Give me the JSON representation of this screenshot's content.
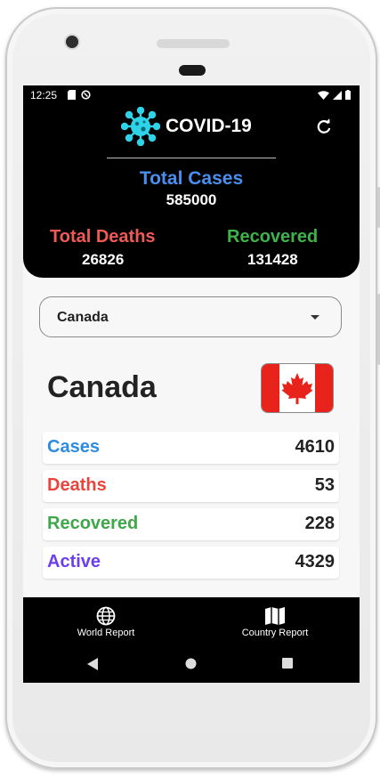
{
  "status_bar": {
    "time": "12:25"
  },
  "header": {
    "app_title": "COVID-19",
    "logo_icon": "virus-icon",
    "refresh_icon": "refresh-icon",
    "total_cases_label": "Total Cases",
    "total_cases_value": "585000",
    "total_deaths_label": "Total Deaths",
    "total_deaths_value": "26826",
    "recovered_label": "Recovered",
    "recovered_value": "131428"
  },
  "country_select": {
    "selected": "Canada"
  },
  "country": {
    "name": "Canada",
    "flag_icon": "canada-flag-icon",
    "stats": [
      {
        "label": "Cases",
        "value": "4610",
        "color": "#2e8be0"
      },
      {
        "label": "Deaths",
        "value": "53",
        "color": "#e8453c"
      },
      {
        "label": "Recovered",
        "value": "228",
        "color": "#3fa64a"
      },
      {
        "label": "Active",
        "value": "4329",
        "color": "#6b3ff0"
      }
    ]
  },
  "bottom_nav": {
    "items": [
      {
        "label": "World Report",
        "icon": "globe-icon"
      },
      {
        "label": "Country Report",
        "icon": "map-icon"
      }
    ]
  },
  "colors": {
    "header_bg": "#000000",
    "total_cases": "#4a8ef0",
    "total_deaths": "#f05a55",
    "recovered": "#3fb24a",
    "virus_logo": "#2fd3e8"
  }
}
